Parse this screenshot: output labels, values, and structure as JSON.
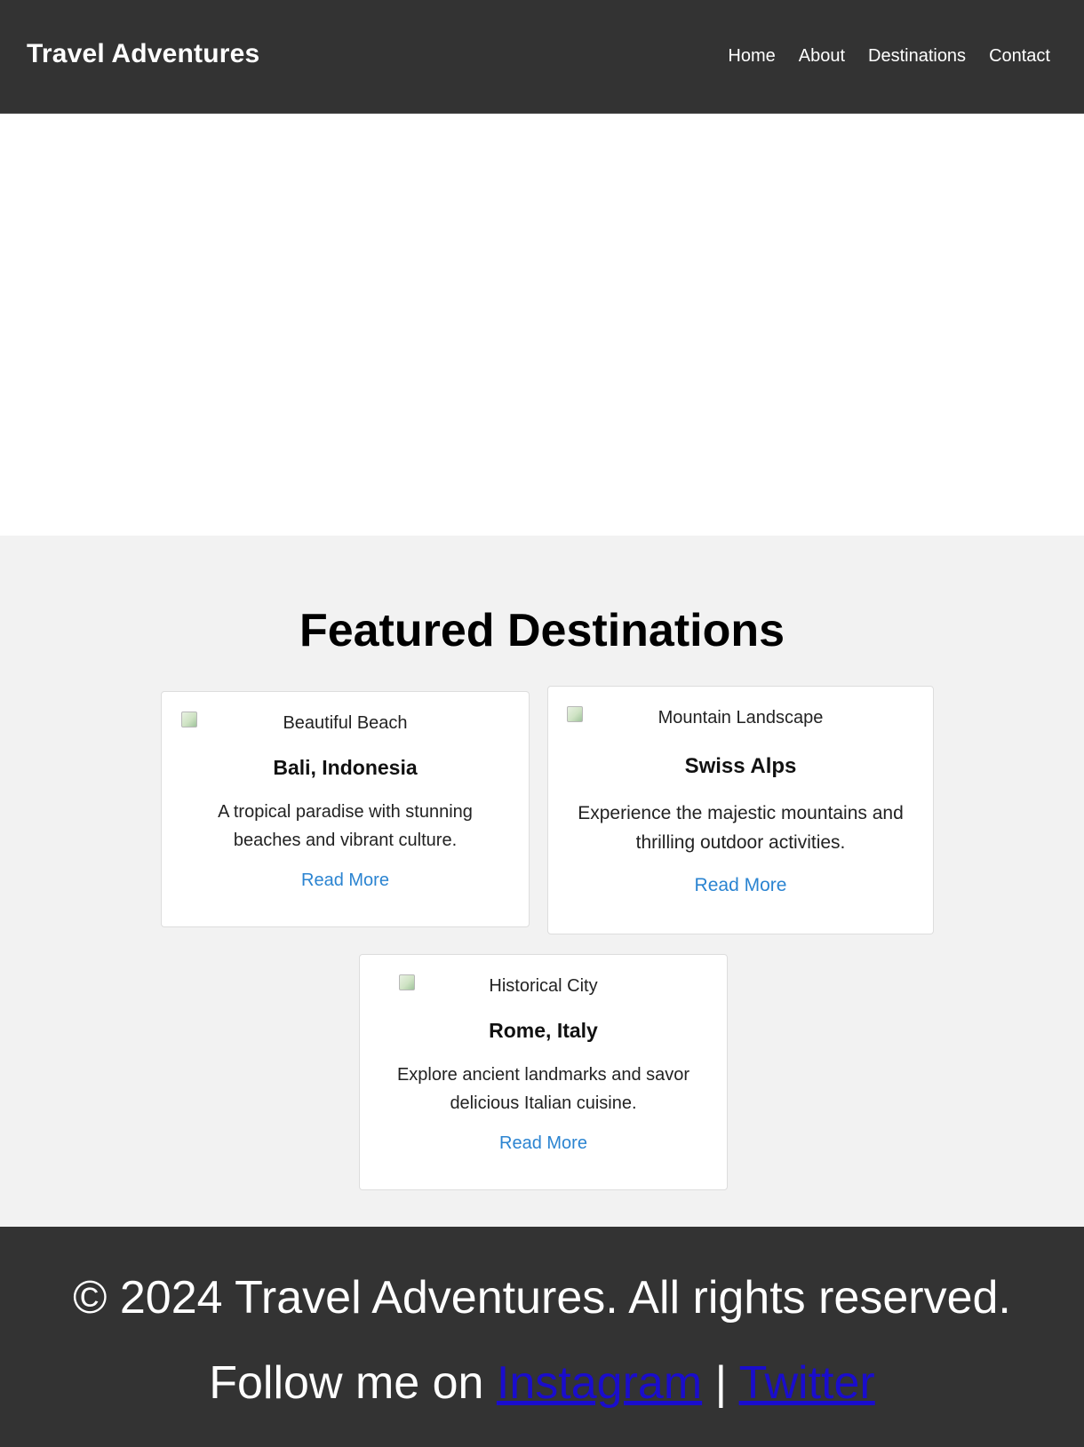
{
  "header": {
    "brand": "Travel Adventures",
    "nav": [
      {
        "label": "Home"
      },
      {
        "label": "About"
      },
      {
        "label": "Destinations"
      },
      {
        "label": "Contact"
      }
    ]
  },
  "featured": {
    "title": "Featured Destinations",
    "cards": [
      {
        "image_alt": "Beautiful Beach",
        "title": "Bali, Indonesia",
        "description": "A tropical paradise with stunning beaches and vibrant culture.",
        "link": "Read More"
      },
      {
        "image_alt": "Mountain Landscape",
        "title": "Swiss Alps",
        "description": "Experience the majestic mountains and thrilling outdoor activities.",
        "link": "Read More"
      },
      {
        "image_alt": "Historical City",
        "title": "Rome, Italy",
        "description": "Explore ancient landmarks and savor delicious Italian cuisine.",
        "link": "Read More"
      }
    ]
  },
  "footer": {
    "copyright": "© 2024 Travel Adventures. All rights reserved.",
    "follow_prefix": "Follow me on ",
    "separator": " | ",
    "links": [
      {
        "label": "Instagram"
      },
      {
        "label": "Twitter"
      }
    ]
  },
  "colors": {
    "header_bg": "#333333",
    "section_bg": "#f2f2f2",
    "link_blue": "#2b84d1",
    "footer_link": "#1a0dcc"
  }
}
